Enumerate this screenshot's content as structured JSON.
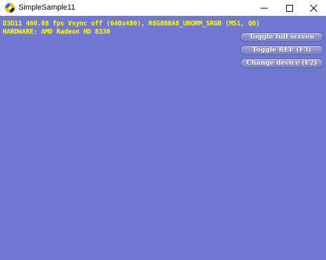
{
  "window": {
    "title": "SimpleSample11",
    "icons": {
      "app": "directx-app-icon",
      "minimize": "minimize-icon",
      "maximize": "maximize-icon",
      "close": "close-icon"
    }
  },
  "stats": {
    "line1": "D3D11 460.88 fps Vsync off (640x480), R8G8B8A8_UNORM_SRGB (MS1, Q0)",
    "line2": "HARDWARE: AMD Radeon HD 8330"
  },
  "buttons": {
    "toggle_full_screen": "Toggle full screen",
    "toggle_ref": "Toggle REF (F3)",
    "change_device": "Change device (F2)"
  },
  "colors": {
    "background": "#7178d4",
    "stats_text": "#ffff00",
    "button_text": "#ffffff"
  }
}
